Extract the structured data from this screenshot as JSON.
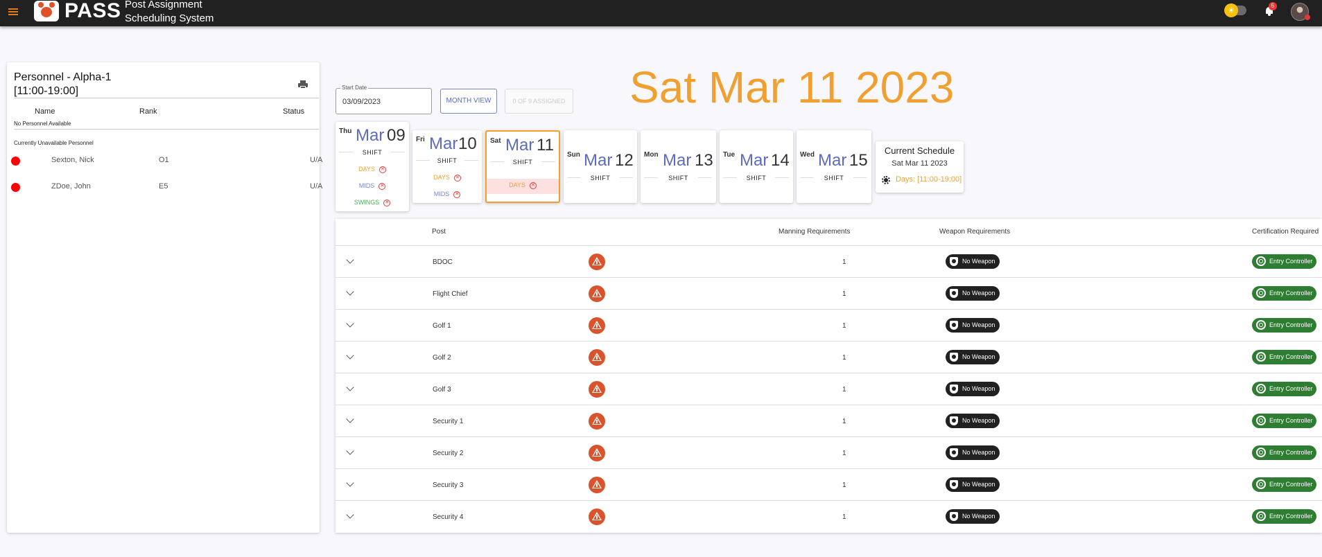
{
  "app": {
    "brand": "PASS",
    "subtitle_line1": "Post Assignment",
    "subtitle_line2": "Scheduling System",
    "notification_count": "5",
    "accent": "#f0a030",
    "topbar_color": "#212121"
  },
  "personnel": {
    "title": "Personnel - Alpha-1",
    "time": "[11:00-19:00]",
    "columns": [
      "Name",
      "Rank",
      "Status"
    ],
    "available_note": "No Personnel Available",
    "unavailable_label": "Currently Unavailable Personnel",
    "unavailable": [
      {
        "name": "Sexton, Nick",
        "rank": "O1",
        "status": "U/A"
      },
      {
        "name": "ZDoe, John",
        "rank": "E5",
        "status": "U/A"
      }
    ]
  },
  "controls": {
    "start_date_label": "Start Date",
    "start_date_value": "03/09/2023",
    "month_view": "MONTH VIEW",
    "assigned": "0 OF 9 ASSIGNED"
  },
  "selected_date": "Sat Mar 11 2023",
  "days": [
    {
      "weekday": "Thu",
      "month": "Mar",
      "day": "09",
      "shift": "SHIFT",
      "slots": [
        "DAYS",
        "MIDS",
        "SWINGS"
      ]
    },
    {
      "weekday": "Fri",
      "month": "Mar",
      "day": "10",
      "shift": "SHIFT",
      "slots": [
        "DAYS",
        "MIDS"
      ]
    },
    {
      "weekday": "Sat",
      "month": "Mar",
      "day": "11",
      "shift": "SHIFT",
      "slots": [
        "DAYS"
      ]
    },
    {
      "weekday": "Sun",
      "month": "Mar",
      "day": "12",
      "shift": "SHIFT",
      "slots": []
    },
    {
      "weekday": "Mon",
      "month": "Mar",
      "day": "13",
      "shift": "SHIFT",
      "slots": []
    },
    {
      "weekday": "Tue",
      "month": "Mar",
      "day": "14",
      "shift": "SHIFT",
      "slots": []
    },
    {
      "weekday": "Wed",
      "month": "Mar",
      "day": "15",
      "shift": "SHIFT",
      "slots": []
    }
  ],
  "current_schedule": {
    "title": "Current Schedule",
    "date": "Sat Mar 11 2023",
    "shift": "Days: [11:00-19:00]"
  },
  "table": {
    "headers": {
      "post": "Post",
      "manning": "Manning Requirements",
      "weapon": "Weapon Requirements",
      "cert": "Certification Required"
    },
    "rows": [
      {
        "post": "BDOC",
        "manning": "1",
        "weapon": "No Weapon",
        "cert": "Entry Controller"
      },
      {
        "post": "Flight Chief",
        "manning": "1",
        "weapon": "No Weapon",
        "cert": "Entry Controller"
      },
      {
        "post": "Golf 1",
        "manning": "1",
        "weapon": "No Weapon",
        "cert": "Entry Controller"
      },
      {
        "post": "Golf 2",
        "manning": "1",
        "weapon": "No Weapon",
        "cert": "Entry Controller"
      },
      {
        "post": "Golf 3",
        "manning": "1",
        "weapon": "No Weapon",
        "cert": "Entry Controller"
      },
      {
        "post": "Security 1",
        "manning": "1",
        "weapon": "No Weapon",
        "cert": "Entry Controller"
      },
      {
        "post": "Security 2",
        "manning": "1",
        "weapon": "No Weapon",
        "cert": "Entry Controller"
      },
      {
        "post": "Security 3",
        "manning": "1",
        "weapon": "No Weapon",
        "cert": "Entry Controller"
      },
      {
        "post": "Security 4",
        "manning": "1",
        "weapon": "No Weapon",
        "cert": "Entry Controller"
      }
    ]
  }
}
